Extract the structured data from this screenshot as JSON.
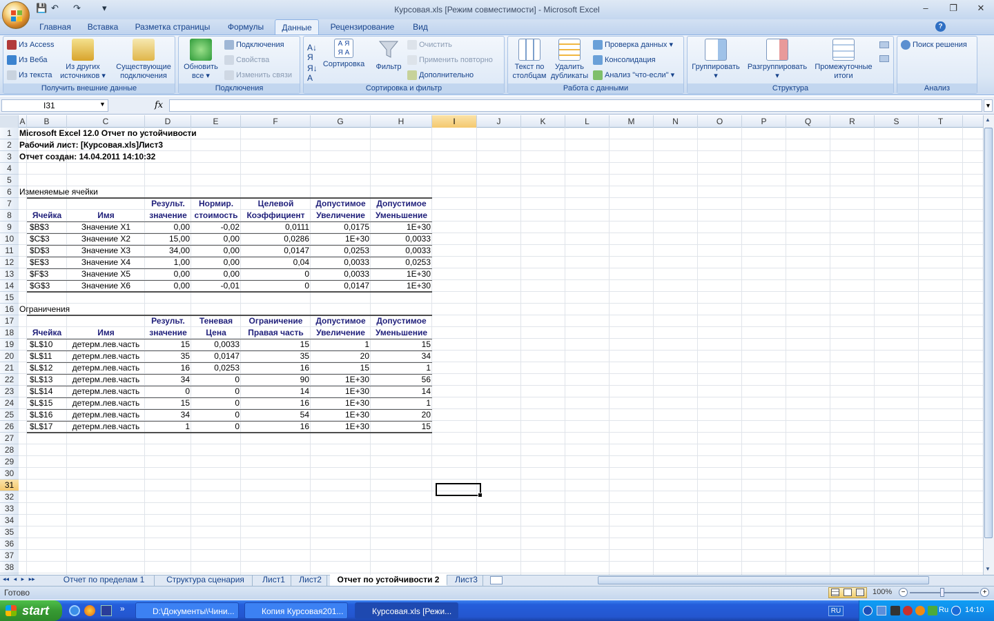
{
  "window": {
    "title": "Курсовая.xls  [Режим совместимости] - Microsoft Excel",
    "minimize": "‒",
    "restore": "❐",
    "close": "✕"
  },
  "quick_access": {
    "save": "💾",
    "undo": "↶",
    "redo": "↷",
    "customize": "▾"
  },
  "ribbon_tabs": [
    "Главная",
    "Вставка",
    "Разметка страницы",
    "Формулы",
    "Данные",
    "Рецензирование",
    "Вид"
  ],
  "active_tab": "Данные",
  "ribbon": {
    "external": {
      "access": "Из Access",
      "web": "Из Веба",
      "text": "Из текста",
      "other_1": "Из других",
      "other_2": "источников ▾",
      "existing_1": "Существующие",
      "existing_2": "подключения",
      "label": "Получить внешние данные"
    },
    "connections": {
      "refresh_1": "Обновить",
      "refresh_2": "все ▾",
      "connections": "Подключения",
      "properties": "Свойства",
      "edit_links": "Изменить связи",
      "label": "Подключения"
    },
    "sort": {
      "sort": "Сортировка",
      "filter": "Фильтр",
      "clear": "Очистить",
      "reapply": "Применить повторно",
      "advanced": "Дополнительно",
      "label": "Сортировка и фильтр"
    },
    "datatools": {
      "t2c_1": "Текст по",
      "t2c_2": "столбцам",
      "dup_1": "Удалить",
      "dup_2": "дубликаты",
      "validation": "Проверка данных ▾",
      "consolidate": "Консолидация",
      "whatif": "Анализ \"что-если\" ▾",
      "label": "Работа с данными"
    },
    "outline": {
      "group": "Группировать",
      "ungroup": "Разгруппировать",
      "subtotal_1": "Промежуточные",
      "subtotal_2": "итоги",
      "label": "Структура"
    },
    "analysis": {
      "solver": "Поиск решения",
      "label": "Анализ"
    }
  },
  "formula_bar": {
    "name_box": "I31",
    "fx": "fx",
    "value": ""
  },
  "columns": [
    "A",
    "B",
    "C",
    "D",
    "E",
    "F",
    "G",
    "H",
    "I",
    "J",
    "K",
    "L",
    "M",
    "N",
    "O",
    "P",
    "Q",
    "R",
    "S",
    "T"
  ],
  "selected_column": "I",
  "rows": [
    "1",
    "2",
    "3",
    "4",
    "5",
    "6",
    "7",
    "8",
    "9",
    "10",
    "11",
    "12",
    "13",
    "14",
    "15",
    "16",
    "17",
    "18",
    "19",
    "20",
    "21",
    "22",
    "23",
    "24",
    "25",
    "26",
    "27",
    "28",
    "29",
    "30",
    "31",
    "32",
    "33",
    "34",
    "35",
    "36",
    "37",
    "38"
  ],
  "selected_row": "31",
  "report": {
    "line1": "Microsoft Excel 12.0 Отчет по устойчивости",
    "line2": "Рабочий лист: [Курсовая.xls]Лист3",
    "line3": "Отчет создан: 14.04.2011 14:10:32",
    "changing_title": "Изменяемые ячейки",
    "changing_header": {
      "top": [
        "",
        "",
        "Результ.",
        "Нормир.",
        "Целевой",
        "Допустимое",
        "Допустимое"
      ],
      "bottom": [
        "Ячейка",
        "Имя",
        "значение",
        "стоимость",
        "Коэффициент",
        "Увеличение",
        "Уменьшение"
      ]
    },
    "changing_rows": [
      [
        "$B$3",
        "Значение X1",
        "0,00",
        "-0,02",
        "0,0111",
        "0,0175",
        "1E+30"
      ],
      [
        "$C$3",
        "Значение X2",
        "15,00",
        "0,00",
        "0,0286",
        "1E+30",
        "0,0033"
      ],
      [
        "$D$3",
        "Значение X3",
        "34,00",
        "0,00",
        "0,0147",
        "0,0253",
        "0,0033"
      ],
      [
        "$E$3",
        "Значение X4",
        "1,00",
        "0,00",
        "0,04",
        "0,0033",
        "0,0253"
      ],
      [
        "$F$3",
        "Значение X5",
        "0,00",
        "0,00",
        "0",
        "0,0033",
        "1E+30"
      ],
      [
        "$G$3",
        "Значение X6",
        "0,00",
        "-0,01",
        "0",
        "0,0147",
        "1E+30"
      ]
    ],
    "constraints_title": "Ограничения",
    "constraints_header": {
      "top": [
        "",
        "",
        "Результ.",
        "Теневая",
        "Ограничение",
        "Допустимое",
        "Допустимое"
      ],
      "bottom": [
        "Ячейка",
        "Имя",
        "значение",
        "Цена",
        "Правая часть",
        "Увеличение",
        "Уменьшение"
      ]
    },
    "constraints_rows": [
      [
        "$L$10",
        "детерм.лев.часть",
        "15",
        "0,0033",
        "15",
        "1",
        "15"
      ],
      [
        "$L$11",
        "детерм.лев.часть",
        "35",
        "0,0147",
        "35",
        "20",
        "34"
      ],
      [
        "$L$12",
        "детерм.лев.часть",
        "16",
        "0,0253",
        "16",
        "15",
        "1"
      ],
      [
        "$L$13",
        "детерм.лев.часть",
        "34",
        "0",
        "90",
        "1E+30",
        "56"
      ],
      [
        "$L$14",
        "детерм.лев.часть",
        "0",
        "0",
        "14",
        "1E+30",
        "14"
      ],
      [
        "$L$15",
        "детерм.лев.часть",
        "15",
        "0",
        "16",
        "1E+30",
        "1"
      ],
      [
        "$L$16",
        "детерм.лев.часть",
        "34",
        "0",
        "54",
        "1E+30",
        "20"
      ],
      [
        "$L$17",
        "детерм.лев.часть",
        "1",
        "0",
        "16",
        "1E+30",
        "15"
      ]
    ]
  },
  "sheet_nav": [
    "◂◂",
    "◂",
    "▸",
    "▸▸"
  ],
  "sheet_tabs": [
    "Отчет по пределам 1",
    "Структура сценария",
    "Лист1",
    "Лист2",
    "Отчет по устойчивости 2",
    "Лист3"
  ],
  "active_sheet": "Отчет по устойчивости 2",
  "status": {
    "ready": "Готово",
    "zoom": "100%"
  },
  "taskbar": {
    "start": "start",
    "items": [
      "D:\\Документы\\Чини...",
      "Копия Курсовая201...",
      "Курсовая.xls  [Режи..."
    ],
    "lang": "RU",
    "tray_lang": "Ru",
    "clock": "14:10"
  }
}
